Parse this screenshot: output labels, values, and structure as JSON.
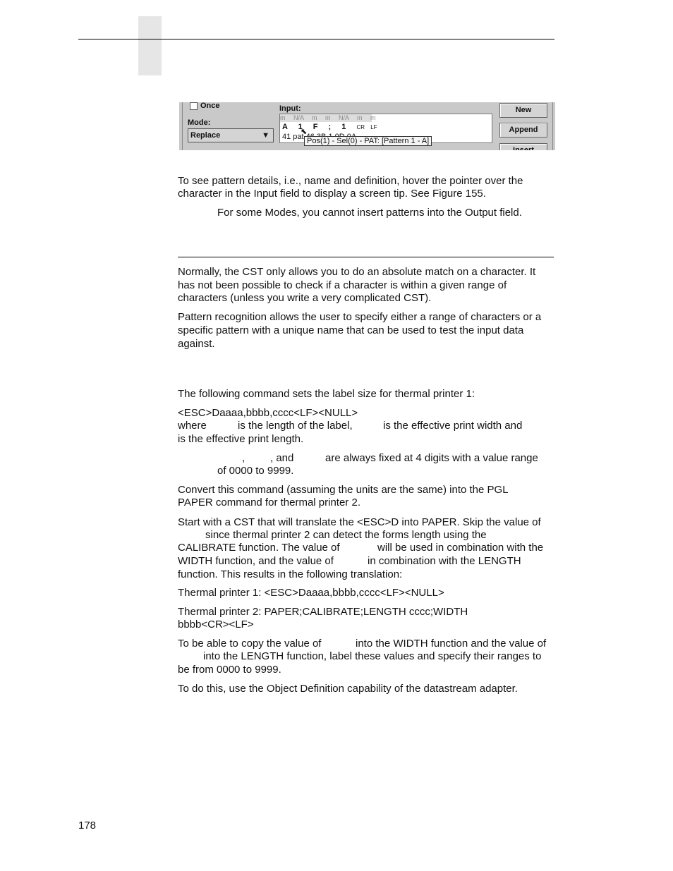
{
  "figure": {
    "once_label": "Once",
    "mode_label": "Mode:",
    "mode_value": "Replace",
    "input_label": "Input:",
    "input_header": [
      "m",
      "N/A",
      "m",
      "m",
      "N/A",
      "m",
      "m"
    ],
    "input_chars": [
      "A",
      "1",
      "F",
      ";",
      "1",
      "CR",
      "LF"
    ],
    "input_hex": "41  pat 46  3B  1  0D  0A",
    "tooltip": "Pos(1) - Sel(0) - PAT: [Pattern 1 - A]",
    "buttons": {
      "new": "New",
      "append": "Append",
      "insert": "Insert"
    }
  },
  "body": {
    "p1": [
      "To see pattern details, i.e., name and definition, hover the pointer over the",
      "character in the Input field to display a screen tip. See Figure 155."
    ],
    "note": "For some Modes, you cannot insert patterns into the Output field.",
    "p2": [
      "Normally, the CST only allows you to do an absolute match on a character. It",
      "has not been possible to check if a character is within a given range of",
      "characters (unless you write a very complicated CST)."
    ],
    "p3": [
      "Pattern recognition allows the user to specify either a range of characters or a",
      "specific pattern with a unique name that can be used to test the input data",
      "against."
    ],
    "p4": "The following command sets the label size for thermal printer 1:",
    "cmd": "<ESC>Daaaa,bbbb,cccc<LF><NULL>",
    "where": [
      "where",
      "is the length of the label,",
      "is the effective print width and"
    ],
    "where2": "is the effective print length.",
    "note2": [
      ",",
      ", and",
      "are always fixed at 4 digits with a value range"
    ],
    "note2b": "of 0000 to 9999.",
    "p5": [
      "Convert this command (assuming the units are the same) into the PGL",
      "PAPER command for thermal printer 2."
    ],
    "p6a": "Start with a CST that will translate the <ESC>D into PAPER. Skip the value of",
    "p6b": "since thermal printer 2 can detect the forms length using the",
    "p6c": [
      "CALIBRATE function. The value of",
      "will be used in combination with the"
    ],
    "p6d": [
      "WIDTH function, and the value of",
      "in combination with the LENGTH"
    ],
    "p6e": "function. This results in the following translation:",
    "p7": "Thermal printer 1: <ESC>Daaaa,bbbb,cccc<LF><NULL>",
    "p8": [
      "Thermal printer 2: PAPER;CALIBRATE;LENGTH cccc;WIDTH",
      "bbbb<CR><LF>"
    ],
    "p9a": [
      "To be able to copy the value of",
      "into the WIDTH function and the value of"
    ],
    "p9b": "into the LENGTH function, label these values and specify their ranges to",
    "p9c": "be from 0000 to 9999.",
    "p10": "To do this, use the Object Definition capability of the datastream adapter."
  },
  "footer": {
    "page_number": "178"
  }
}
